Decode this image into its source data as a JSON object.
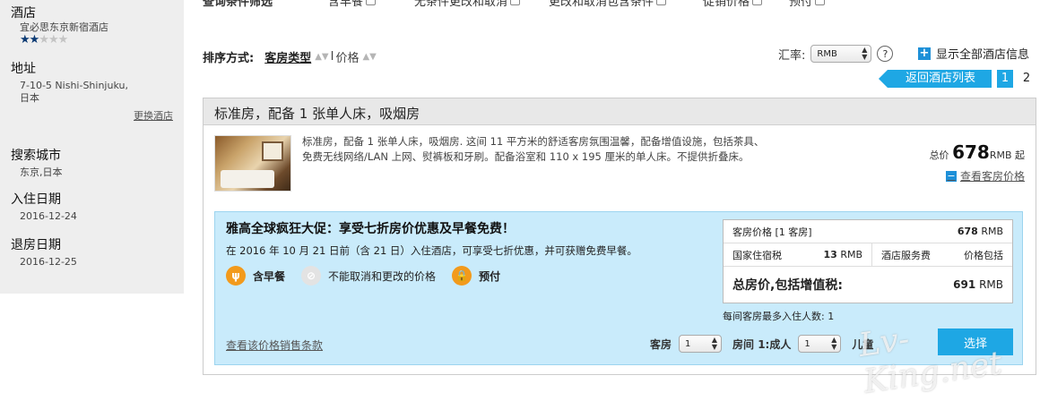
{
  "sidebar": {
    "hotel_label": "酒店",
    "hotel_name": "宜必思东京新宿酒店",
    "stars": {
      "filled": 2,
      "total": 5
    },
    "address_label": "地址",
    "address_line1": "7-10-5 Nishi-Shinjuku,",
    "address_line2": "日本",
    "change_hotel": "更换酒店",
    "city_label": "搜索城市",
    "city_value": "东京,日本",
    "checkin_label": "入住日期",
    "checkin_value": "2016-12-24",
    "checkout_label": "退房日期",
    "checkout_value": "2016-12-25"
  },
  "filterbar": {
    "title": "查询条件筛选",
    "items": [
      "含早餐",
      "无条件更改和取消",
      "更改和取消包含条件",
      "促销价格",
      "预付"
    ]
  },
  "sort": {
    "title": "排序方式:",
    "key_room_type": "客房类型",
    "separator": "I",
    "key_price": "价格"
  },
  "currency": {
    "label": "汇率:",
    "value": "RMB",
    "help": "?"
  },
  "show_all": "显示全部酒店信息",
  "pager": {
    "back": "返回酒店列表",
    "pages": [
      "1",
      "2"
    ],
    "active": "1"
  },
  "room": {
    "title": "标准房，配备 1 张单人床，吸烟房",
    "description": "标准房，配备 1 张单人床，吸烟房. 这间 11 平方米的舒适客房氛围温馨，配备增值设施，包括茶具、免费无线网络/LAN 上网、熨裤板和牙刷。配备浴室和 110 x 195 厘米的单人床。不提供折叠床。",
    "price_prefix": "总价",
    "price": "678",
    "price_suffix": "RMB 起",
    "view_rooms": "查看客房价格"
  },
  "promo": {
    "title": "雅高全球疯狂大促：享受七折房价优惠及早餐免费！",
    "text": "在 2016 年 10 月 21 日前（含 21 日）入住酒店，可享受七折优惠，并可获赠免费早餐。",
    "features": [
      {
        "icon": "breakfast-icon",
        "label": "含早餐"
      },
      {
        "icon": "no-cancel-icon",
        "label": "不能取消和更改的价格"
      },
      {
        "icon": "lock-icon",
        "label": "预付"
      }
    ],
    "colors": {
      "accent": "#f29a1c",
      "panel": "#c9ebfb",
      "button": "#1ea7e4"
    }
  },
  "pricetable": {
    "room_price_label": "客房价格 [1 客房]",
    "room_price_value": "678",
    "room_price_unit": "RMB",
    "tax_label": "国家住宿税",
    "tax_value": "13",
    "tax_unit": "RMB",
    "service_label": "酒店服务费",
    "service_value": "价格包括",
    "total_label": "总房价,包括增值税:",
    "total_value": "691",
    "total_unit": "RMB",
    "max_guests": "每间客房最多入住人数: 1"
  },
  "booking": {
    "sale_terms": "查看该价格销售条款",
    "rooms_label": "客房",
    "rooms_value": "1",
    "adults_label": "房间 1:成人",
    "adults_value": "1",
    "children_label": "儿童",
    "book_button": "选择"
  },
  "watermark": "Lv-King.net"
}
